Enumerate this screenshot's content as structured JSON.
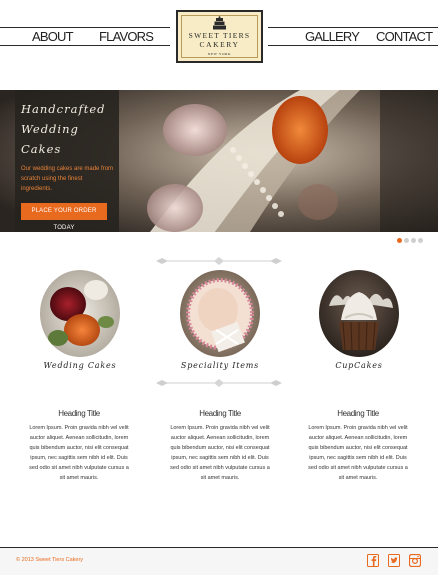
{
  "header": {
    "nav_left": [
      "ABOUT",
      "FLAVORS"
    ],
    "nav_right": [
      "GALLERY",
      "CONTACT"
    ],
    "logo": {
      "line1": "SWEET TIERS",
      "line2": "CAKERY",
      "line3": "NEW YORK"
    }
  },
  "hero": {
    "title": [
      "Handcrafted",
      "Wedding",
      "Cakes"
    ],
    "description": "Our wedding cakes are made from scratch using the finest ingredients.",
    "cta_label": "PLACE YOUR ORDER TODAY",
    "slides": {
      "count": 4,
      "active": 1
    }
  },
  "products": [
    {
      "name": "Wedding Cakes"
    },
    {
      "name": "Speciality Items"
    },
    {
      "name": "CupCakes"
    }
  ],
  "columns": [
    {
      "heading": "Heading Title",
      "body": "Lorem Ipsum. Proin gravida nibh vel velit auctor aliquet. Aenean sollicitudin, lorem quis bibendum auctor, nisi elit consequat ipsum, nec sagittis sem nibh id elit. Duis sed odio sit amet nibh vulputate cursus a sit amet mauris."
    },
    {
      "heading": "Heading Title",
      "body": "Lorem Ipsum. Proin gravida nibh vel velit auctor aliquet. Aenean sollicitudin, lorem quis bibendum auctor, nisi elit consequat ipsum, nec sagittis sem nibh id elit. Duis sed odio sit amet nibh vulputate cursus a sit amet mauris."
    },
    {
      "heading": "Heading Title",
      "body": "Lorem Ipsum. Proin gravida nibh vel velit auctor aliquet. Aenean sollicitudin, lorem quis bibendum auctor, nisi elit consequat ipsum, nec sagittis sem nibh id elit. Duis sed odio sit amet nibh vulputate cursus a sit amet mauris."
    }
  ],
  "footer": {
    "copyright": "© 2013 Sweet Tiers Cakery",
    "social": [
      "facebook-icon",
      "twitter-icon",
      "instagram-icon"
    ]
  },
  "colors": {
    "accent": "#e86a1f",
    "dark": "#2a2a2a",
    "logo_bg": "#f7ecc5"
  }
}
